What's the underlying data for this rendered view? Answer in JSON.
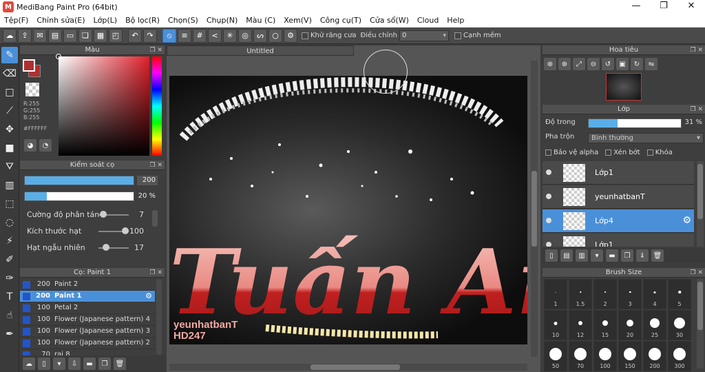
{
  "window": {
    "title": "MediBang Paint Pro (64bit)",
    "minimize": "—",
    "maximize": "❐",
    "close": "✕"
  },
  "menu": [
    "Tệp(F)",
    "Chỉnh sửa(E)",
    "Lớp(L)",
    "Bộ lọc(R)",
    "Chọn(S)",
    "Chụp(N)",
    "Màu (C)",
    "Xem(V)",
    "Công cụ(T)",
    "Cửa sổ(W)",
    "Cloud",
    "Help"
  ],
  "toolbar": {
    "antialias_label": "Khử răng cưa",
    "adjust_label": "Điều chỉnh",
    "adjust_value": "0",
    "edge_label": "Cạnh mềm"
  },
  "color_panel": {
    "title": "Màu",
    "rgb": [
      "R:255",
      "G:255",
      "B:255"
    ],
    "hex": "#FFFFFF",
    "fg_color": "#b03030"
  },
  "brush_control": {
    "title": "Kiểm soát cọ",
    "size_value": "200",
    "size_fill": 1.0,
    "opacity_value": "20 %",
    "opacity_fill": 0.2,
    "params": [
      {
        "label": "Cường độ phân tán",
        "value": "7",
        "level": 0.05
      },
      {
        "label": "Kích thước hạt",
        "value": "100",
        "level": 1.0
      },
      {
        "label": "Hạt ngẫu nhiên",
        "value": "17",
        "level": 0.17
      }
    ]
  },
  "brush_list": {
    "title": "Cọ: Paint 1",
    "items": [
      {
        "size": "200",
        "name": "Paint 2"
      },
      {
        "size": "200",
        "name": "Paint 1"
      },
      {
        "size": "100",
        "name": "Petal 2"
      },
      {
        "size": "100",
        "name": "Flower (Japanese pattern) 4"
      },
      {
        "size": "100",
        "name": "Flower (Japanese pattern) 3"
      },
      {
        "size": "100",
        "name": "Flower (Japanese pattern) 2"
      },
      {
        "size": "70",
        "name": "rai 8"
      }
    ],
    "selected_index": 1
  },
  "canvas": {
    "tab": "Untitled",
    "art_text_main": "Tuấn Anh",
    "art_text_sub1": "yeunhatbanT",
    "art_text_sub2": "HD247"
  },
  "navigator": {
    "title": "Hoa tiêu"
  },
  "layers": {
    "title": "Lớp",
    "opacity_label": "Độ trong",
    "opacity_value": "31 %",
    "opacity_fill": 0.31,
    "blend_label": "Pha trộn",
    "blend_value": "Bình thường",
    "protect_alpha": "Bảo vệ alpha",
    "clipping": "Xén bớt",
    "lock": "Khóa",
    "items": [
      {
        "name": "Lớp1"
      },
      {
        "name": "yeunhatbanT"
      },
      {
        "name": "Lớp4"
      },
      {
        "name": "Lớp1"
      }
    ],
    "selected_index": 2
  },
  "brush_size": {
    "title": "Brush Size",
    "sizes": [
      "1",
      "1.5",
      "2",
      "3",
      "4",
      "5",
      "10",
      "12",
      "15",
      "20",
      "25",
      "30",
      "50",
      "70",
      "100",
      "150",
      "200",
      "300"
    ]
  }
}
